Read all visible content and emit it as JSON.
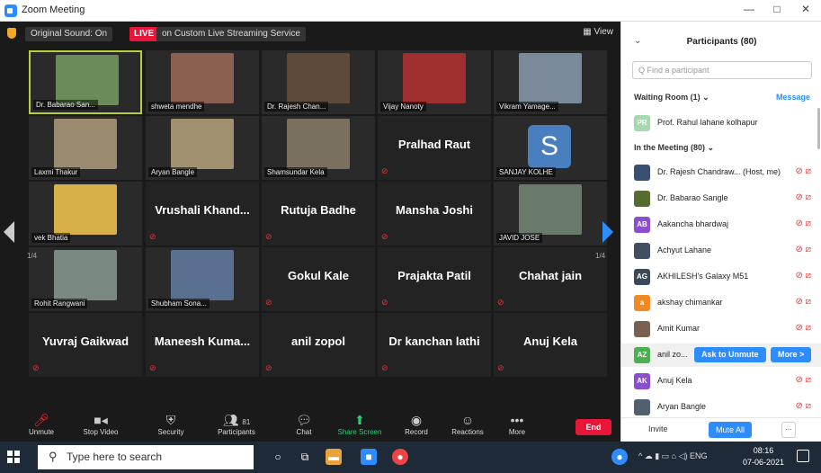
{
  "window": {
    "title": "Zoom Meeting",
    "minimize": "—",
    "maximize": "□",
    "close": "✕"
  },
  "topbar": {
    "sound": "Original Sound: On",
    "live_badge": "LIVE",
    "live_text": "on Custom Live Streaming Service",
    "view": "View"
  },
  "gallery": {
    "page_left": "1/4",
    "page_right": "1/4",
    "tiles": [
      {
        "name": "Dr. Babarao San...",
        "type": "video",
        "color": "#6b8c5a"
      },
      {
        "name": "shweta mendhe",
        "type": "video",
        "color": "#8a6050"
      },
      {
        "name": "Dr. Rajesh Chan...",
        "type": "video",
        "color": "#5d4a3a"
      },
      {
        "name": "Vijay Nanoty",
        "type": "video",
        "color": "#a03030"
      },
      {
        "name": "Vikram Yamage...",
        "type": "video",
        "color": "#7a8a9a"
      },
      {
        "name": "Laxmi Thakur",
        "type": "video",
        "color": "#9a8a70"
      },
      {
        "name": "Aryan Bangle",
        "type": "video",
        "color": "#a09070"
      },
      {
        "name": "Shamsundar Kela",
        "type": "video",
        "color": "#7a7060"
      },
      {
        "name": "Pralhad Raut",
        "type": "name"
      },
      {
        "name": "SANJAY KOLHE",
        "type": "avatar",
        "letter": "S"
      },
      {
        "name": "vek Bhatia",
        "type": "video",
        "color": "#d8b04a"
      },
      {
        "name": "Vrushali Khand...",
        "type": "name"
      },
      {
        "name": "Rutuja Badhe",
        "type": "name"
      },
      {
        "name": "Mansha Joshi",
        "type": "name"
      },
      {
        "name": "JAVID JOSE",
        "type": "video",
        "color": "#6a7a6a"
      },
      {
        "name": "Rohit Rangwani",
        "type": "video",
        "color": "#7a8a80"
      },
      {
        "name": "Shubham Sona...",
        "type": "video",
        "color": "#5a7090"
      },
      {
        "name": "Gokul Kale",
        "type": "name"
      },
      {
        "name": "Prajakta Patil",
        "type": "name"
      },
      {
        "name": "Chahat jain",
        "type": "name"
      },
      {
        "name": "Yuvraj Gaikwad",
        "type": "name"
      },
      {
        "name": "Maneesh Kuma...",
        "type": "name"
      },
      {
        "name": "anil zopol",
        "type": "name"
      },
      {
        "name": "Dr kanchan lathi",
        "type": "name"
      },
      {
        "name": "Anuj Kela",
        "type": "name"
      }
    ]
  },
  "toolbar": {
    "unmute": "Unmute",
    "stop_video": "Stop Video",
    "security": "Security",
    "participants": "Participants",
    "participants_count": "81",
    "chat": "Chat",
    "share_screen": "Share Screen",
    "record": "Record",
    "reactions": "Reactions",
    "more": "More",
    "end": "End"
  },
  "panel": {
    "title": "Participants (80)",
    "search_placeholder": "Q Find a participant",
    "waiting_room": "Waiting Room (1)",
    "message": "Message",
    "in_meeting": "In the Meeting (80)",
    "invite": "Invite",
    "mute_all": "Mute All",
    "more_dots": "...",
    "ask_to_unmute": "Ask to Unmute",
    "more_btn": "More >",
    "waiting": [
      {
        "initials": "PR",
        "name": "Prof. Rahul lahane kolhapur",
        "color": "#a8d8b0"
      }
    ],
    "participants": [
      {
        "initials": "",
        "name": "Dr. Rajesh Chandraw... (Host, me)",
        "color": "#3a5070"
      },
      {
        "initials": "",
        "name": "Dr. Babarao Sangle",
        "color": "#556b2f"
      },
      {
        "initials": "AB",
        "name": "Aakancha bhardwaj",
        "color": "#8a4fd0"
      },
      {
        "initials": "",
        "name": "Achyut Lahane",
        "color": "#405060"
      },
      {
        "initials": "AG",
        "name": "AKHILESH's Galaxy M51",
        "color": "#3a4a58"
      },
      {
        "initials": "a",
        "name": "akshay chimankar",
        "color": "#f08a24"
      },
      {
        "initials": "",
        "name": "Amit Kumar",
        "color": "#7a6050"
      },
      {
        "initials": "AZ",
        "name": "anil zo...",
        "color": "#4caf50"
      },
      {
        "initials": "AK",
        "name": "Anuj Kela",
        "color": "#8a4fd0"
      },
      {
        "initials": "",
        "name": "Aryan Bangle",
        "color": "#506070"
      }
    ]
  },
  "taskbar": {
    "search_placeholder": "Type here to search",
    "lang": "ENG",
    "time": "08:16",
    "date": "07-06-2021"
  }
}
